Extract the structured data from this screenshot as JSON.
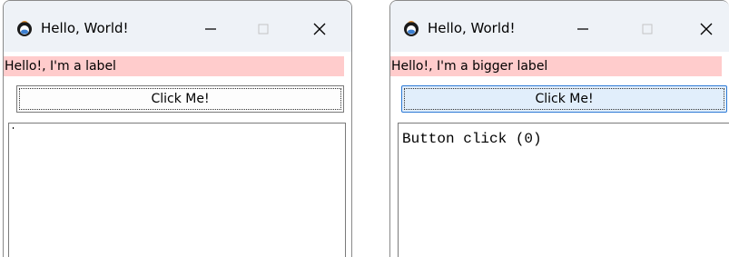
{
  "windows": [
    {
      "title": "Hello, World!",
      "app_icon": "python-turtle-icon",
      "controls": [
        "minimize-icon",
        "maximize-icon",
        "close-icon"
      ],
      "label_text": "Hello!, I'm a label",
      "label_bg": "#ffcccc",
      "button_label": "Click Me!",
      "button_state": "default",
      "textbox_value": ""
    },
    {
      "title": "Hello, World!",
      "app_icon": "python-turtle-icon",
      "controls": [
        "minimize-icon",
        "maximize-icon",
        "close-icon"
      ],
      "label_text": "Hello!, I'm a bigger label",
      "label_bg": "#ffcccc",
      "button_label": "Click Me!",
      "button_state": "hover",
      "textbox_value": "Button click (0)"
    }
  ],
  "colors": {
    "titlebar_bg": "#eef2f7",
    "button_hover_bg": "#e1eefb",
    "button_hover_border": "#2d7ad6"
  }
}
